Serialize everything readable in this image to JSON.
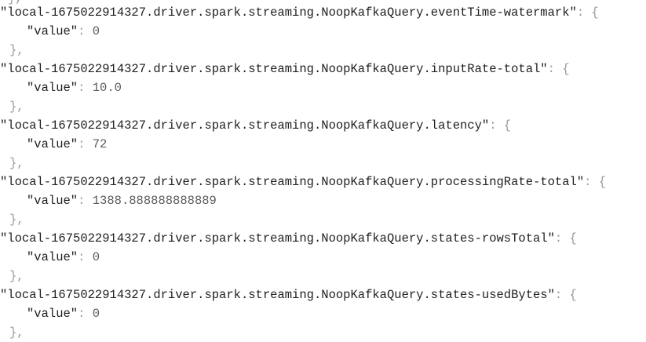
{
  "json_view": {
    "entries": [
      {
        "key": "\"local-1675022914327.driver.spark.streaming.NoopKafkaQuery.eventTime-watermark\"",
        "value_key": "\"value\"",
        "value": "0"
      },
      {
        "key": "\"local-1675022914327.driver.spark.streaming.NoopKafkaQuery.inputRate-total\"",
        "value_key": "\"value\"",
        "value": "10.0"
      },
      {
        "key": "\"local-1675022914327.driver.spark.streaming.NoopKafkaQuery.latency\"",
        "value_key": "\"value\"",
        "value": "72"
      },
      {
        "key": "\"local-1675022914327.driver.spark.streaming.NoopKafkaQuery.processingRate-total\"",
        "value_key": "\"value\"",
        "value": "1388.888888888889"
      },
      {
        "key": "\"local-1675022914327.driver.spark.streaming.NoopKafkaQuery.states-rowsTotal\"",
        "value_key": "\"value\"",
        "value": "0"
      },
      {
        "key": "\"local-1675022914327.driver.spark.streaming.NoopKafkaQuery.states-usedBytes\"",
        "value_key": "\"value\"",
        "value": "0"
      }
    ],
    "colon_brace": ": {",
    "colon": ": ",
    "close": "},",
    "top_fragment": "},"
  }
}
